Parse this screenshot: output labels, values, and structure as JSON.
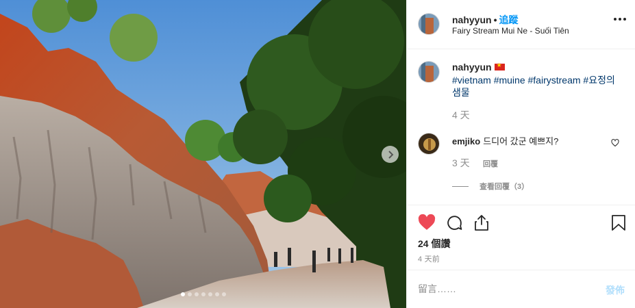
{
  "post": {
    "username": "nahyyun",
    "follow_separator": "•",
    "follow_label": "追蹤",
    "location": "Fairy Stream Mui Ne - Suối Tiên"
  },
  "caption": {
    "username": "nahyyun",
    "flag_icon": "vietnam-flag-icon",
    "text": "#vietnam #muine #fairystream #요정의샘물",
    "time": "4 天"
  },
  "comments": [
    {
      "username": "emjiko",
      "text": "드디어 갔군 예쁘지?",
      "time": "3 天",
      "reply_label": "回覆",
      "view_replies": "查看回覆（3）"
    }
  ],
  "actions": {
    "likes": "24 個讚",
    "posted_ago": "4 天前"
  },
  "composer": {
    "placeholder": "留言……",
    "post_label": "發佈",
    "post_color": "#b2dffc"
  },
  "carousel": {
    "slide_count": 7,
    "active_index": 0
  },
  "colors": {
    "like_red": "#ed4956",
    "link_blue": "#00376b",
    "follow_blue": "#0095f6"
  }
}
